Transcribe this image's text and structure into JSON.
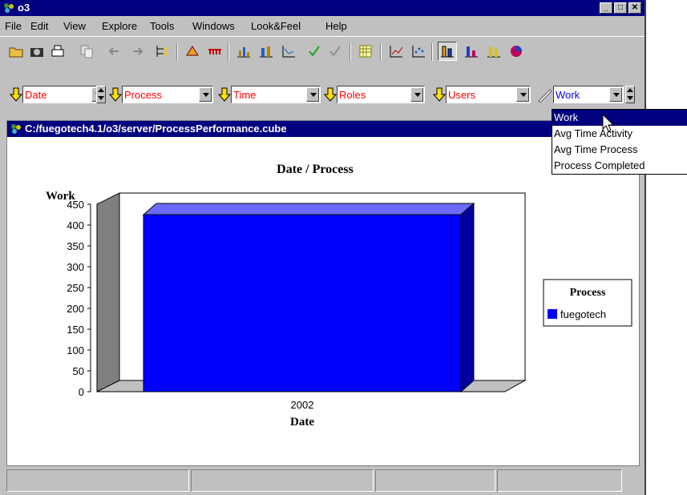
{
  "window": {
    "title": "o3"
  },
  "menus": [
    "File",
    "Edit",
    "View",
    "Explore",
    "Tools",
    "Windows",
    "Look&Feel",
    "Help"
  ],
  "toolbar": {
    "buttons": [
      "open-icon",
      "camera-icon",
      "print-icon",
      "copy-icon",
      "back-arrow-icon",
      "forward-arrow-icon",
      "tree-icon",
      "explore-icon",
      "link-icon",
      "bar-chart-icon",
      "stacked-chart-icon",
      "axis-chart-icon",
      "check-icon",
      "check-outline-icon",
      "grid-icon",
      "line-chart-icon",
      "scatter-chart-icon",
      "bar-chart-3d-icon",
      "bar-chart-3d-alt-icon",
      "bar-chart-3d-yellow-icon",
      "pie-chart-icon"
    ]
  },
  "dimensions": [
    {
      "label": "Date"
    },
    {
      "label": "Process"
    },
    {
      "label": "Time"
    },
    {
      "label": "Roles"
    },
    {
      "label": "Users"
    }
  ],
  "measure": {
    "selected": "Work"
  },
  "measure_options": [
    "Work",
    "Avg Time Activity",
    "Avg Time Process",
    "Process Completed"
  ],
  "inner_window": {
    "title": "C:/fuegotech4.1/o3/server/ProcessPerformance.cube"
  },
  "chart_data": {
    "type": "bar",
    "title": "Date / Process",
    "xlabel": "Date",
    "ylabel": "Work",
    "categories": [
      "2002"
    ],
    "series": [
      {
        "name": "fuegotech",
        "values": [
          425
        ],
        "color": "#0000ff"
      }
    ],
    "ylim": [
      0,
      450
    ],
    "yticks": [
      0,
      50,
      100,
      150,
      200,
      250,
      300,
      350,
      400,
      450
    ],
    "legend": {
      "title": "Process",
      "position": "right"
    },
    "three_d": true
  },
  "colors": {
    "titlebar": "#000080",
    "dimension_text": "#ff0000",
    "bar": "#0000ff"
  }
}
